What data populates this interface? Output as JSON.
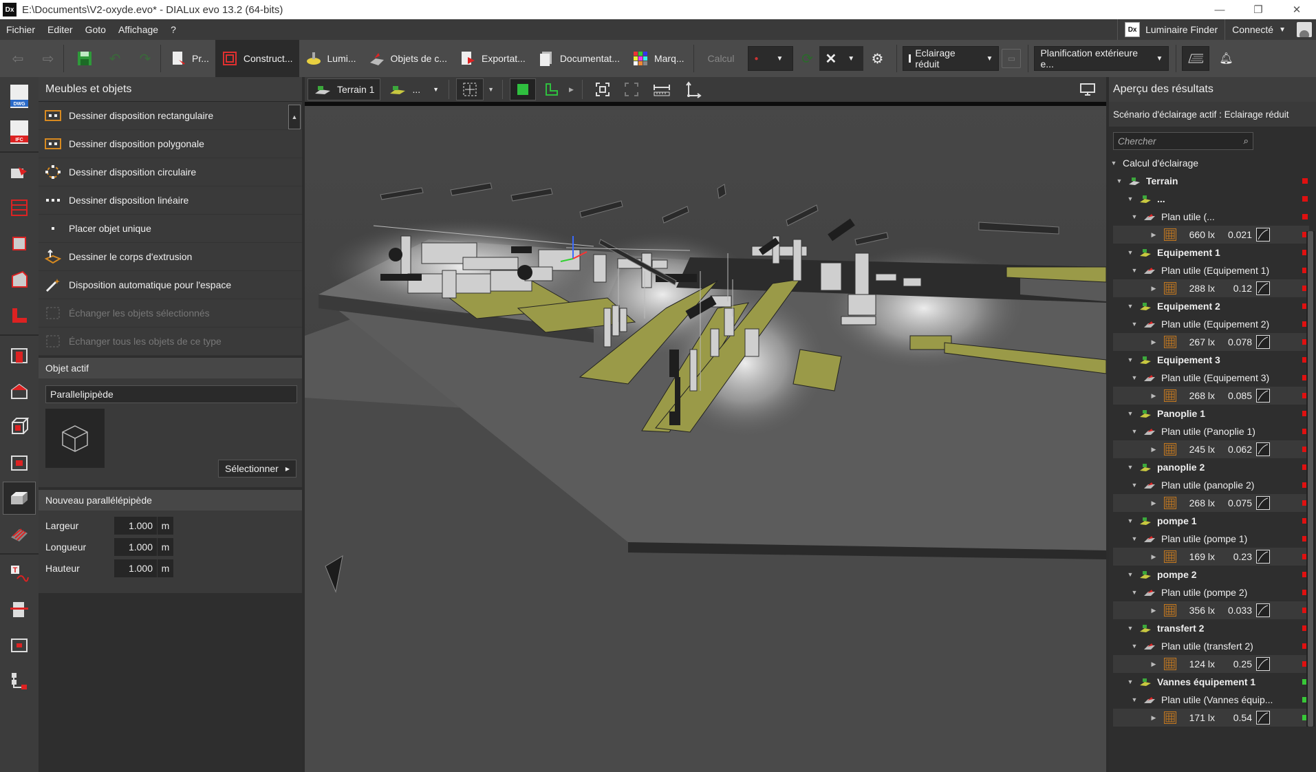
{
  "window": {
    "title": "E:\\Documents\\V2-oxyde.evo* - DIALux evo 13.2  (64-bits)",
    "app_icon": "Dx",
    "controls": [
      "—",
      "❐",
      "✕"
    ]
  },
  "menubar": {
    "items": [
      "Fichier",
      "Editer",
      "Goto",
      "Affichage",
      "?"
    ],
    "luminaire_finder": "Luminaire Finder",
    "connected": "Connecté"
  },
  "toolbar": {
    "tabs": [
      "Pr...",
      "Construct...",
      "Lumi...",
      "Objets de c...",
      "Exportat...",
      "Documentat...",
      "Marq..."
    ],
    "active_tab_index": 1,
    "calcul": "Calcul",
    "scenario_dropdown": "Eclairage réduit",
    "planning_dropdown": "Planification extérieure e..."
  },
  "left_panel": {
    "header": "Meubles et objets",
    "items": [
      {
        "label": "Dessiner disposition rectangulaire",
        "disabled": false
      },
      {
        "label": "Dessiner disposition polygonale",
        "disabled": false
      },
      {
        "label": "Dessiner disposition circulaire",
        "disabled": false
      },
      {
        "label": "Dessiner disposition linéaire",
        "disabled": false
      },
      {
        "label": "Placer objet unique",
        "disabled": false
      },
      {
        "label": "Dessiner le corps d'extrusion",
        "disabled": false
      },
      {
        "label": "Disposition automatique pour l'espace",
        "disabled": false
      },
      {
        "label": "Échanger les objets sélectionnés",
        "disabled": true
      },
      {
        "label": "Échanger tous les objets de ce type",
        "disabled": true
      }
    ],
    "active_object": {
      "header": "Objet actif",
      "name": "Parallelipipède",
      "select_button": "Sélectionner"
    },
    "new_box": {
      "header": "Nouveau parallélépipède",
      "fields": [
        {
          "label": "Largeur",
          "value": "1.000",
          "unit": "m"
        },
        {
          "label": "Longueur",
          "value": "1.000",
          "unit": "m"
        },
        {
          "label": "Hauteur",
          "value": "1.000",
          "unit": "m"
        }
      ]
    }
  },
  "view_toolbar": {
    "terrain": "Terrain 1",
    "more": "..."
  },
  "right_panel": {
    "header": "Aperçu des résultats",
    "scenario": "Scénario d'éclairage actif : Eclairage réduit",
    "search_placeholder": "Chercher",
    "calc_label": "Calcul d'éclairage",
    "terrain": "Terrain",
    "colors": {
      "red": "#e01010",
      "green": "#38c838"
    },
    "groups": [
      {
        "name": "...",
        "plan": "Plan utile (...",
        "lux": "660 lx",
        "u": "0.021",
        "status": "red"
      },
      {
        "name": "Equipement 1",
        "plan": "Plan utile (Equipement 1)",
        "lux": "288 lx",
        "u": "0.12",
        "status": "red"
      },
      {
        "name": "Equipement 2",
        "plan": "Plan utile (Equipement 2)",
        "lux": "267 lx",
        "u": "0.078",
        "status": "red"
      },
      {
        "name": "Equipement 3",
        "plan": "Plan utile (Equipement 3)",
        "lux": "268 lx",
        "u": "0.085",
        "status": "red"
      },
      {
        "name": "Panoplie 1",
        "plan": "Plan utile (Panoplie 1)",
        "lux": "245 lx",
        "u": "0.062",
        "status": "red"
      },
      {
        "name": "panoplie 2",
        "plan": "Plan utile (panoplie 2)",
        "lux": "268 lx",
        "u": "0.075",
        "status": "red"
      },
      {
        "name": "pompe 1",
        "plan": "Plan utile (pompe 1)",
        "lux": "169 lx",
        "u": "0.23",
        "status": "red"
      },
      {
        "name": "pompe 2",
        "plan": "Plan utile (pompe 2)",
        "lux": "356 lx",
        "u": "0.033",
        "status": "red"
      },
      {
        "name": "transfert 2",
        "plan": "Plan utile (transfert 2)",
        "lux": "124 lx",
        "u": "0.25",
        "status": "red"
      },
      {
        "name": "Vannes équipement 1",
        "plan": "Plan utile (Vannes équip...",
        "lux": "171 lx",
        "u": "0.54",
        "status": "green"
      }
    ]
  }
}
